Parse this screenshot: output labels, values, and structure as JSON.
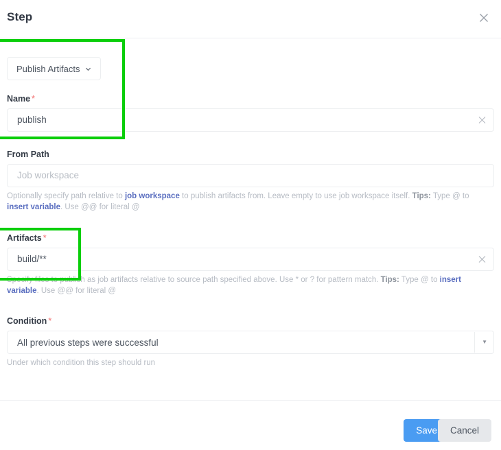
{
  "dialog": {
    "title": "Step",
    "close_icon": "close-icon"
  },
  "step_type": {
    "label": "Publish Artifacts",
    "caret_icon": "chevron-down-icon"
  },
  "fields": {
    "name": {
      "label": "Name",
      "required_marker": "*",
      "value": "publish",
      "clear_icon": "clear-icon"
    },
    "from_path": {
      "label": "From Path",
      "placeholder": "Job workspace",
      "value": "",
      "hint": {
        "part1": "Optionally specify path relative to ",
        "link1": "job workspace",
        "part2": " to publish artifacts from. Leave empty to use job workspace itself. ",
        "tips_label": "Tips:",
        "part3": " Type @ to ",
        "link2": "insert variable",
        "part4": ". Use @@ for literal @"
      }
    },
    "artifacts": {
      "label": "Artifacts",
      "required_marker": "*",
      "value": "build/**",
      "clear_icon": "clear-icon",
      "hint": {
        "part1": "Specify files to publish as job artifacts relative to source path specified above. Use * or ? for pattern match. ",
        "tips_label": "Tips:",
        "part2": " Type @ to ",
        "link": "insert variable",
        "part3": ". Use @@ for literal @"
      }
    },
    "condition": {
      "label": "Condition",
      "required_marker": "*",
      "selected": "All previous steps were successful",
      "caret_icon": "caret-down-icon",
      "hint": "Under which condition this step should run"
    }
  },
  "footer": {
    "save_label": "Save",
    "cancel_label": "Cancel"
  },
  "colors": {
    "accent": "#4a9cf2",
    "required": "#f26d6d",
    "link": "#5b6fc0",
    "highlight": "#0ace0a"
  }
}
